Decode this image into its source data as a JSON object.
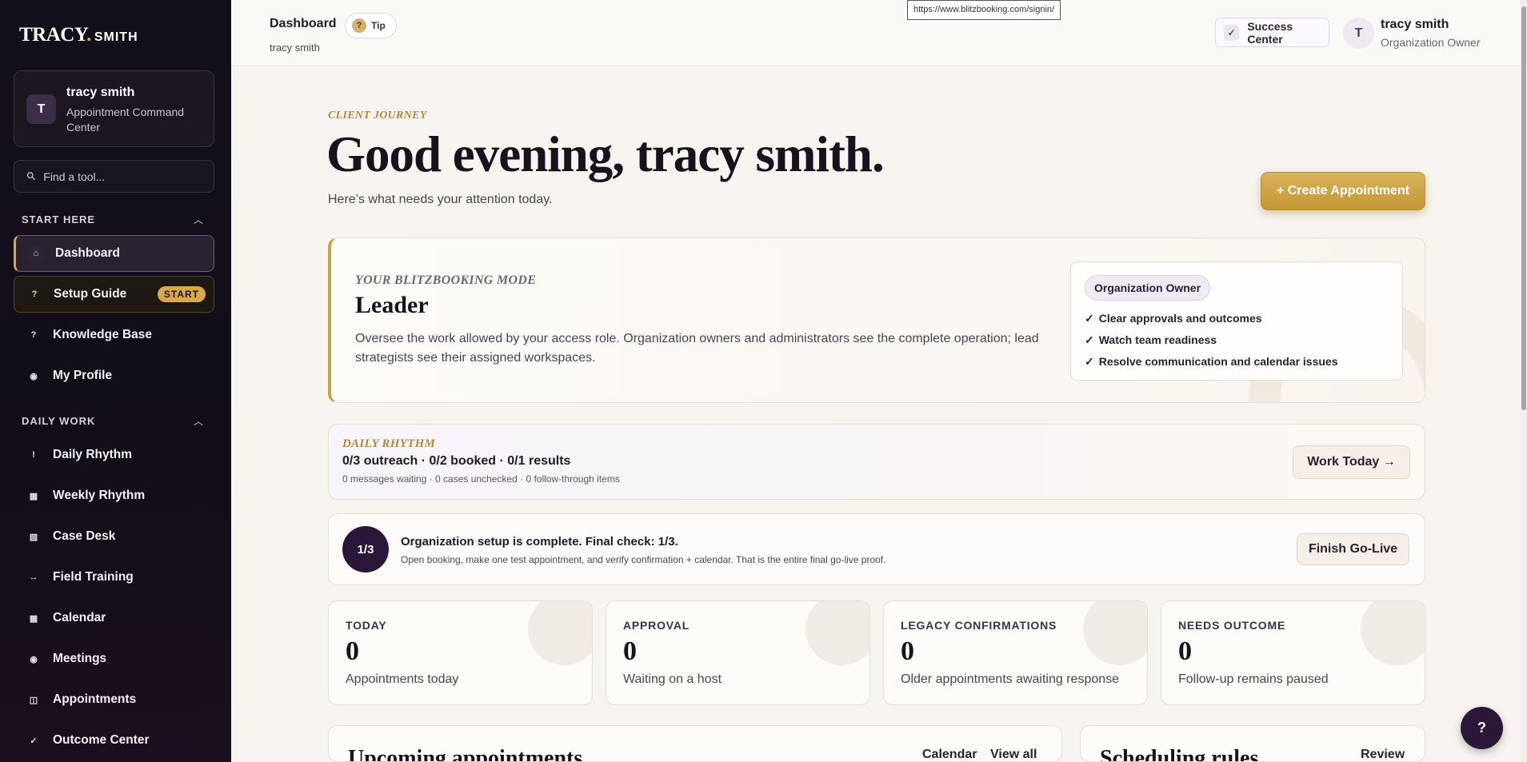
{
  "logo": {
    "main": "TRACY",
    "dot": ".",
    "small": "SMITH"
  },
  "org": {
    "avatar": "T",
    "name": "tracy smith",
    "subtitle": "Appointment Command Center"
  },
  "search": {
    "placeholder": "Find a tool...",
    "icon": "search-icon"
  },
  "sections": {
    "start_here": "START HERE",
    "daily_work": "DAILY WORK"
  },
  "nav": {
    "start_here": [
      {
        "label": "Dashboard",
        "icon": "⌂",
        "icon_name": "home-icon"
      },
      {
        "label": "Setup Guide",
        "icon": "?",
        "icon_name": "question-icon",
        "badge": "START"
      },
      {
        "label": "Knowledge Base",
        "icon": "?",
        "icon_name": "question-icon"
      },
      {
        "label": "My Profile",
        "icon": "◉",
        "icon_name": "profile-icon"
      }
    ],
    "daily_work": [
      {
        "label": "Daily Rhythm",
        "icon": "!",
        "icon_name": "alert-icon"
      },
      {
        "label": "Weekly Rhythm",
        "icon": "▦",
        "icon_name": "grid-icon"
      },
      {
        "label": "Case Desk",
        "icon": "▧",
        "icon_name": "case-icon"
      },
      {
        "label": "Field Training",
        "icon": "↔",
        "icon_name": "arrows-icon"
      },
      {
        "label": "Calendar",
        "icon": "▦",
        "icon_name": "calendar-icon"
      },
      {
        "label": "Meetings",
        "icon": "◉",
        "icon_name": "meetings-icon"
      },
      {
        "label": "Appointments",
        "icon": "◫",
        "icon_name": "appointments-icon"
      },
      {
        "label": "Outcome Center",
        "icon": "✓",
        "icon_name": "check-icon"
      }
    ]
  },
  "topbar": {
    "title": "Dashboard",
    "tip": "Tip",
    "subtitle": "tracy smith",
    "url_tooltip": "https://www.blitzbooking.com/signin/",
    "success_center": "Success Center",
    "user_avatar": "T",
    "user_name": "tracy smith",
    "user_role": "Organization Owner"
  },
  "greeting": {
    "eyebrow": "CLIENT JOURNEY",
    "title": "Good evening, tracy smith.",
    "subtitle": "Here’s what needs your attention today.",
    "create_button": "+ Create Appointment"
  },
  "mode": {
    "eyebrow": "YOUR BLITZBOOKING MODE",
    "title": "Leader",
    "description": "Oversee the work allowed by your access role. Organization owners and administrators see the complete operation; lead strategists see their assigned workspaces.",
    "role_pill": "Organization Owner",
    "points": [
      "Clear approvals and outcomes",
      "Watch team readiness",
      "Resolve communication and calendar issues"
    ]
  },
  "rhythm": {
    "eyebrow": "DAILY RHYTHM",
    "main": "0/3 outreach · 0/2 booked · 0/1 results",
    "sub": "0 messages waiting · 0 cases unchecked · 0 follow-through items",
    "button": "Work Today →"
  },
  "setup": {
    "progress": "1/3",
    "main": "Organization setup is complete. Final check: 1/3.",
    "sub": "Open booking, make one test appointment, and verify confirmation + calendar. That is the entire final go-live proof.",
    "button": "Finish Go-Live"
  },
  "stats": [
    {
      "label": "TODAY",
      "value": "0",
      "desc": "Appointments today"
    },
    {
      "label": "APPROVAL",
      "value": "0",
      "desc": "Waiting on a host"
    },
    {
      "label": "LEGACY CONFIRMATIONS",
      "value": "0",
      "desc": "Older appointments awaiting response"
    },
    {
      "label": "NEEDS OUTCOME",
      "value": "0",
      "desc": "Follow-up remains paused"
    }
  ],
  "upcoming": {
    "title": "Upcoming appointments",
    "calendar_link": "Calendar",
    "view_all_link": "View all"
  },
  "rules": {
    "title": "Scheduling rules",
    "review_link": "Review"
  },
  "help_fab": "?"
}
